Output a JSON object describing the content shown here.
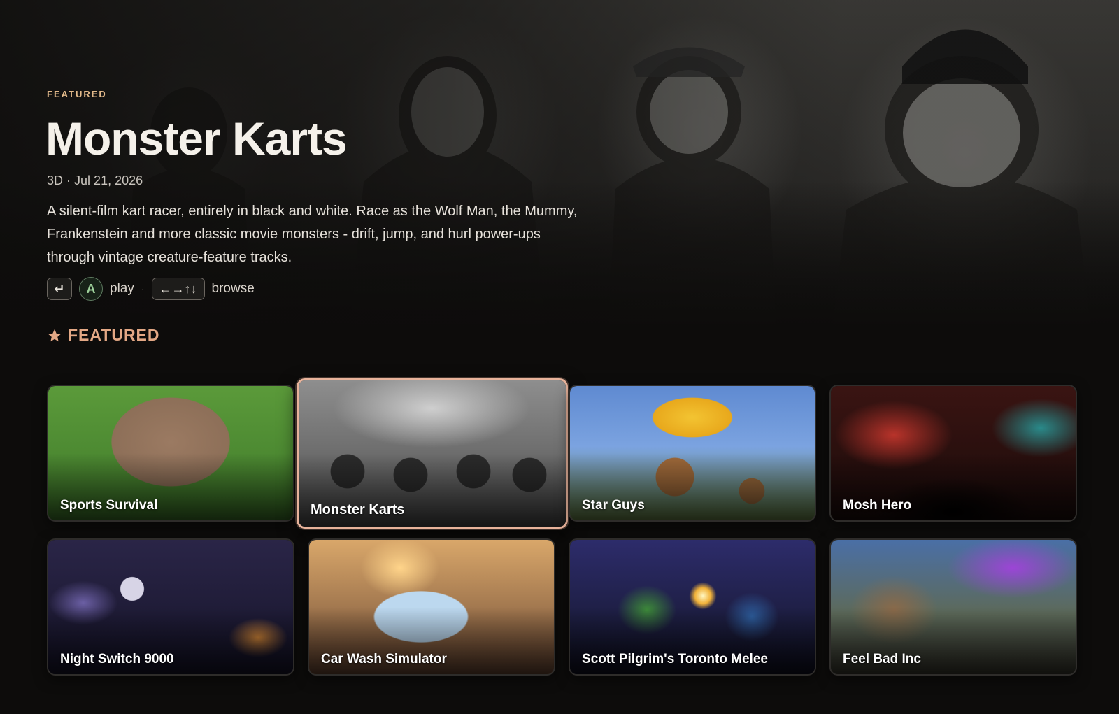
{
  "hero": {
    "eyebrow": "FEATURED",
    "title": "Monster Karts",
    "meta_genre": "3D",
    "meta_separator": "·",
    "meta_date": "Jul 21, 2026",
    "description": "A silent-film kart racer, entirely in black and white. Race as the Wolf Man, the Mummy, Frankenstein and more classic movie monsters - drift, jump, and hurl power-ups through vintage creature-feature tracks.",
    "controls": {
      "enter_key": "↵",
      "a_button": "A",
      "play_label": "play",
      "separator": "·",
      "arrows_key": "←→↑↓",
      "browse_label": "browse"
    }
  },
  "section": {
    "icon": "star-icon",
    "title": "FEATURED"
  },
  "games": [
    {
      "title": "Sports Survival",
      "selected": false
    },
    {
      "title": "Monster Karts",
      "selected": true
    },
    {
      "title": "Star Guys",
      "selected": false
    },
    {
      "title": "Mosh Hero",
      "selected": false
    },
    {
      "title": "Night Switch 9000",
      "selected": false
    },
    {
      "title": "Car Wash Simulator",
      "selected": false
    },
    {
      "title": "Scott Pilgrim's Toronto Melee",
      "selected": false
    },
    {
      "title": "Feel Bad Inc",
      "selected": false
    }
  ],
  "colors": {
    "background": "#0d0c0b",
    "accent": "#e3a885",
    "eyebrow": "#e2b98a",
    "selection_border": "#e8b39b"
  }
}
